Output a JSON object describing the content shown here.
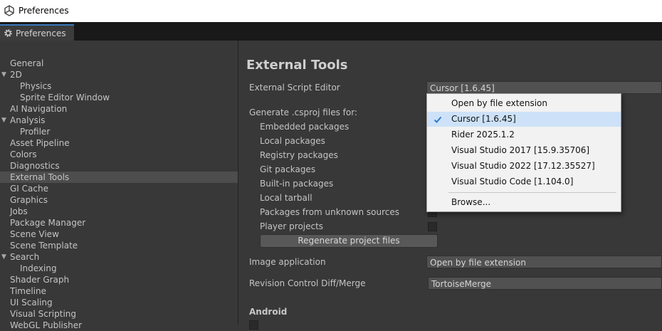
{
  "window": {
    "title": "Preferences"
  },
  "tab": {
    "label": "Preferences"
  },
  "sidebar": {
    "items": [
      {
        "label": "General",
        "indent": 0
      },
      {
        "label": "2D",
        "indent": 0,
        "expanded": true
      },
      {
        "label": "Physics",
        "indent": 1
      },
      {
        "label": "Sprite Editor Window",
        "indent": 1
      },
      {
        "label": "AI Navigation",
        "indent": 0
      },
      {
        "label": "Analysis",
        "indent": 0,
        "expanded": true
      },
      {
        "label": "Profiler",
        "indent": 1
      },
      {
        "label": "Asset Pipeline",
        "indent": 0
      },
      {
        "label": "Colors",
        "indent": 0
      },
      {
        "label": "Diagnostics",
        "indent": 0
      },
      {
        "label": "External Tools",
        "indent": 0,
        "selected": true
      },
      {
        "label": "GI Cache",
        "indent": 0
      },
      {
        "label": "Graphics",
        "indent": 0
      },
      {
        "label": "Jobs",
        "indent": 0
      },
      {
        "label": "Package Manager",
        "indent": 0
      },
      {
        "label": "Scene View",
        "indent": 0
      },
      {
        "label": "Scene Template",
        "indent": 0
      },
      {
        "label": "Search",
        "indent": 0,
        "expanded": true
      },
      {
        "label": "Indexing",
        "indent": 1
      },
      {
        "label": "Shader Graph",
        "indent": 0
      },
      {
        "label": "Timeline",
        "indent": 0
      },
      {
        "label": "UI Scaling",
        "indent": 0
      },
      {
        "label": "Visual Scripting",
        "indent": 0
      },
      {
        "label": "WebGL Publisher",
        "indent": 0
      }
    ]
  },
  "main": {
    "title": "External Tools",
    "external_script_editor": {
      "label": "External Script Editor",
      "value": "Cursor [1.6.45]"
    },
    "generate_label": "Generate .csproj files for:",
    "packages": [
      {
        "label": "Embedded packages"
      },
      {
        "label": "Local packages"
      },
      {
        "label": "Registry packages"
      },
      {
        "label": "Git packages"
      },
      {
        "label": "Built-in packages"
      },
      {
        "label": "Local tarball"
      },
      {
        "label": "Packages from unknown sources"
      },
      {
        "label": "Player projects"
      }
    ],
    "regenerate_button": "Regenerate project files",
    "image_application": {
      "label": "Image application",
      "value": "Open by file extension"
    },
    "revision_control": {
      "label": "Revision Control Diff/Merge",
      "value": "TortoiseMerge"
    },
    "android_section": "Android"
  },
  "dropdown": {
    "items": [
      {
        "label": "Open by file extension",
        "checked": false
      },
      {
        "label": "Cursor [1.6.45]",
        "checked": true
      },
      {
        "label": "Rider 2025.1.2",
        "checked": false
      },
      {
        "label": "Visual Studio 2017 [15.9.35706]",
        "checked": false
      },
      {
        "label": "Visual Studio 2022 [17.12.35527]",
        "checked": false
      },
      {
        "label": "Visual Studio Code [1.104.0]",
        "checked": false
      }
    ],
    "browse": "Browse..."
  },
  "colors": {
    "accent": "#3a79bb",
    "check": "#2a6fc9",
    "selected_row": "#4d4d4d"
  }
}
